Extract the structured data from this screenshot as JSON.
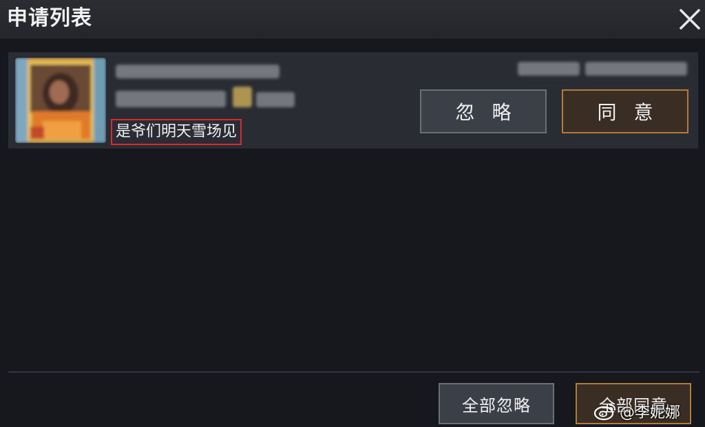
{
  "window": {
    "title": "申请列表",
    "close_icon": "close-icon"
  },
  "request": {
    "avatar_icon": "player-avatar (pixelated)",
    "name": "",
    "details": "",
    "timestamp": "",
    "message": "是爷们明天雪场见",
    "ignore_label": "忽 略",
    "accept_label": "同 意"
  },
  "footer": {
    "ignore_all_label": "全部忽略",
    "accept_all_label": "全部同意"
  },
  "watermark": {
    "text": "@李妮娜",
    "icon": "weibo-logo-icon"
  },
  "colors": {
    "background": "#17181d",
    "titlebar": "#2b2d33",
    "row": "#2a2c33",
    "accent_gold": "#b67b36",
    "highlight_red": "#e02a2a"
  }
}
